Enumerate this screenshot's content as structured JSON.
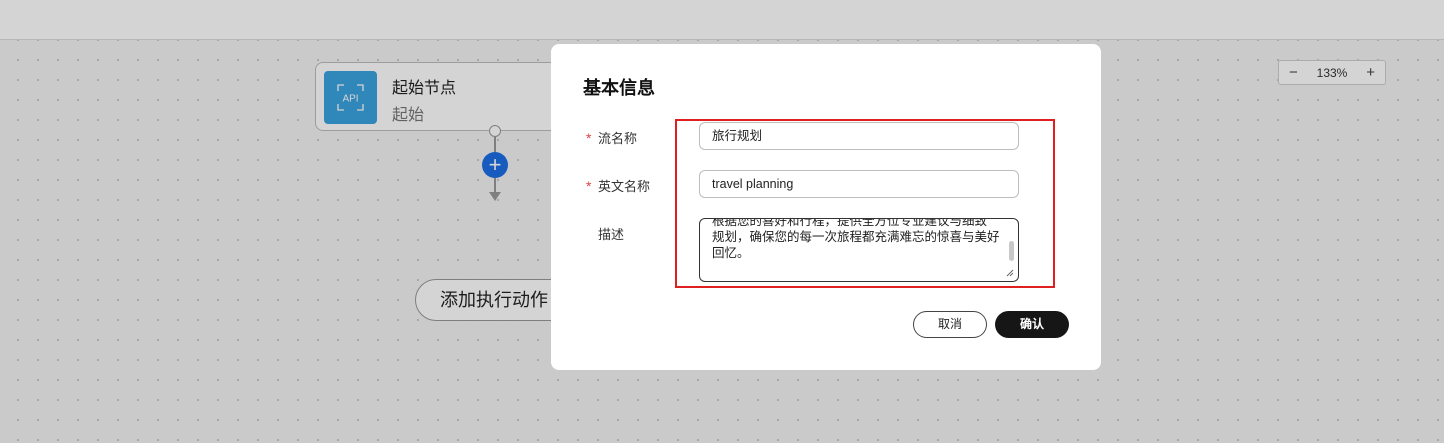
{
  "canvas": {
    "zoom": {
      "minus": "−",
      "level": "133%",
      "plus": "+"
    },
    "start_node": {
      "title": "起始节点",
      "subtitle": "起始",
      "icon_label": "API"
    },
    "add_step": "+",
    "add_action_label": "添加执行动作"
  },
  "dialog": {
    "title": "基本信息",
    "required_mark": "*",
    "fields": {
      "flow_name": {
        "label": "流名称",
        "value": "旅行规划"
      },
      "english_name": {
        "label": "英文名称",
        "value": "travel planning"
      },
      "description": {
        "label": "描述",
        "lines": [
          "根据您的喜好和行程，提供全方位专业建议与细致",
          "规划，确保您的每一次旅程都充满难忘的惊喜与美好",
          "回忆。"
        ]
      }
    },
    "buttons": {
      "cancel": "取消",
      "confirm": "确认"
    }
  },
  "colors": {
    "highlight_border": "#e02020",
    "confirm_button": "#161616",
    "add_button": "#1e6ee6",
    "api_icon_bg": "#3aa3e0"
  }
}
